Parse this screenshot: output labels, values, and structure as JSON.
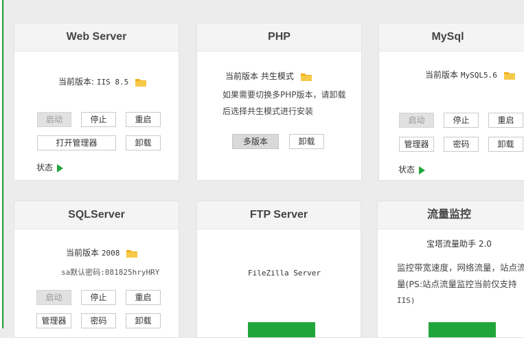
{
  "colors": {
    "accent": "#20a53a",
    "folder": "#f2b01c"
  },
  "cards": {
    "web": {
      "title": "Web Server",
      "version_prefix": "当前版本:",
      "version": "IIS 8.5",
      "buttons": {
        "start": "启动",
        "stop": "停止",
        "restart": "重启",
        "manager": "打开管理器",
        "uninstall": "卸载"
      },
      "status_label": "状态"
    },
    "php": {
      "title": "PHP",
      "version_line": "当前版本 共生模式",
      "desc_line1": "如果需要切换多PHP版本，请卸载",
      "desc_line2": "后选择共生模式进行安装",
      "buttons": {
        "multi": "多版本",
        "uninstall": "卸载"
      }
    },
    "mysql": {
      "title": "MySql",
      "version_prefix": "当前版本",
      "version": "MySQL5.6",
      "buttons": {
        "start": "启动",
        "stop": "停止",
        "restart": "重启",
        "manager": "管理器",
        "password": "密码",
        "uninstall": "卸载"
      },
      "status_label": "状态"
    },
    "sqlserver": {
      "title": "SQLServer",
      "version_prefix": "当前版本",
      "version": "2008",
      "password_line": "sa默认密码:081825hryHRY",
      "buttons": {
        "start": "启动",
        "stop": "停止",
        "restart": "重启",
        "manager": "管理器",
        "password": "密码",
        "uninstall": "卸载"
      }
    },
    "ftp": {
      "title": "FTP Server",
      "software": "FileZilla Server"
    },
    "traffic": {
      "title": "流量监控",
      "helper": "宝塔流量助手 2.0",
      "desc_line1": "监控带宽速度，网络流量，站点流",
      "desc_line2": "量(PS:站点流量监控当前仅支持",
      "desc_line3": "IIS)"
    }
  }
}
